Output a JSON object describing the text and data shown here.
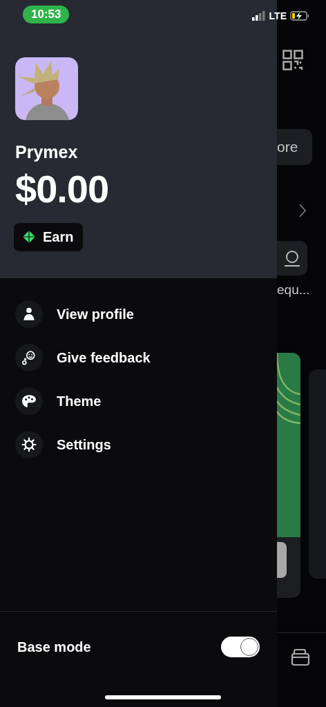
{
  "status_bar": {
    "time": "10:53",
    "network": "LTE"
  },
  "drawer": {
    "name": "Prymex",
    "balance": "$0.00",
    "earn_button": "Earn",
    "menu": [
      {
        "label": "View profile",
        "kind": "person"
      },
      {
        "label": "Give feedback",
        "kind": "feedback"
      },
      {
        "label": "Theme",
        "kind": "palette"
      },
      {
        "label": "Settings",
        "kind": "gear"
      }
    ],
    "base_mode": {
      "label": "Base mode",
      "on": true
    }
  },
  "background": {
    "button_fragment": "ore",
    "text_fragment": "equ..."
  }
}
